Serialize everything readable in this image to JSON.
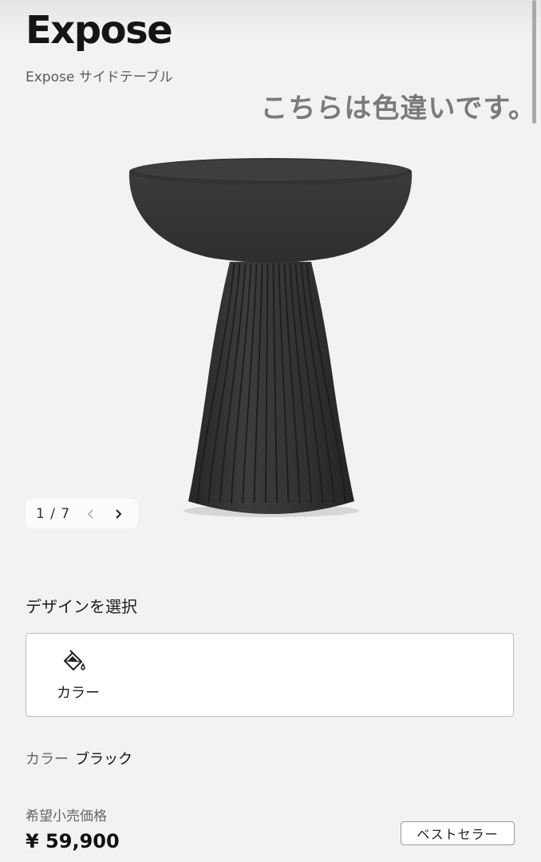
{
  "product": {
    "title": "Expose",
    "subtitle": "Expose サイドテーブル",
    "overlay_note": "こちらは色違いです。"
  },
  "gallery": {
    "counter": "1 / 7",
    "prev_icon": "chevron-left-icon",
    "next_icon": "chevron-right-icon"
  },
  "design": {
    "section_label": "デザインを選択",
    "option_label": "カラー",
    "option_icon": "paint-bucket-icon"
  },
  "selection": {
    "color_key": "カラー",
    "color_value": "ブラック"
  },
  "pricing": {
    "label": "希望小売価格",
    "price": "¥ 59,900",
    "badge": "ベストセラー"
  },
  "colors": {
    "product": "#3a3a3c",
    "background": "#f2f2f2"
  }
}
